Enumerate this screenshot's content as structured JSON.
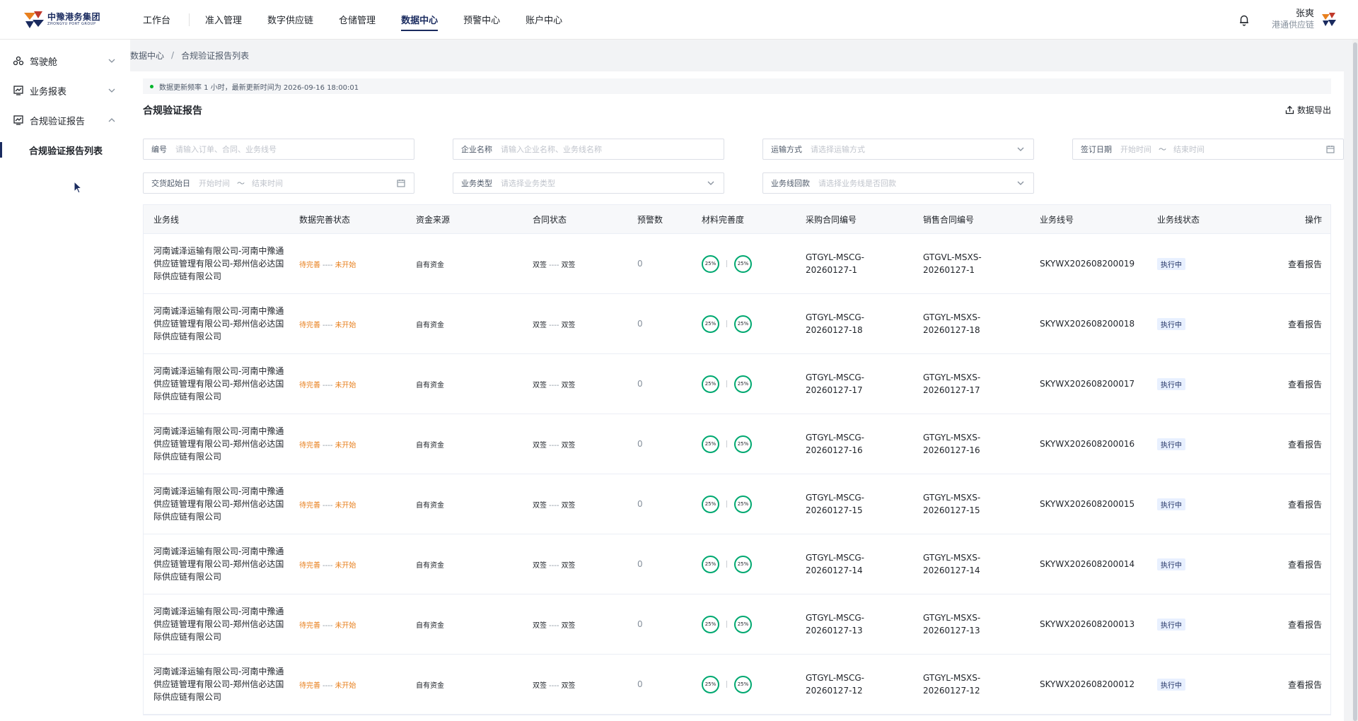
{
  "header": {
    "logo_cn": "中豫港务集团",
    "logo_en": "ZHONGYU PORT GROUP",
    "nav": [
      {
        "label": "工作台"
      },
      {
        "label": "准入管理"
      },
      {
        "label": "数字供应链"
      },
      {
        "label": "仓储管理"
      },
      {
        "label": "数据中心"
      },
      {
        "label": "预警中心"
      },
      {
        "label": "账户中心"
      }
    ],
    "active_nav": "数据中心",
    "user_name": "张爽",
    "user_org": "港通供应链"
  },
  "sidebar": {
    "items": [
      {
        "label": "驾驶舱",
        "icon": "cockpit-icon",
        "chevron": "chevron-down-icon"
      },
      {
        "label": "业务报表",
        "icon": "report-chart-icon",
        "chevron": "chevron-down-icon"
      },
      {
        "label": "合规验证报告",
        "icon": "report-chart-icon",
        "chevron": "chevron-up-icon"
      }
    ],
    "subitems": [
      {
        "label": "合规验证报告列表"
      }
    ]
  },
  "breadcrumb": {
    "parent": "数据中心",
    "separator": "/",
    "current": "合规验证报告列表"
  },
  "notice": "数据更新频率 1 小时，最新更新时间为 2026-09-16 18:00:01",
  "page_title": "合规验证报告",
  "export_label": "数据导出",
  "filters": {
    "code": {
      "label": "编号",
      "placeholder": "请输入订单、合同、业务线号"
    },
    "company": {
      "label": "企业名称",
      "placeholder": "请输入企业名称、业务线名称"
    },
    "transport": {
      "label": "运输方式",
      "placeholder": "请选择运输方式"
    },
    "sign_date": {
      "label": "签订日期",
      "start": "开始时间",
      "tilde": "～",
      "end": "结束时间"
    },
    "delivery_date": {
      "label": "交货起始日",
      "start": "开始时间",
      "tilde": "～",
      "end": "结束时间"
    },
    "biz_type": {
      "label": "业务类型",
      "placeholder": "请选择业务类型"
    },
    "payback": {
      "label": "业务线回款",
      "placeholder": "请选择业务线是否回款"
    }
  },
  "table": {
    "headers": [
      "业务线",
      "数据完善状态",
      "资金来源",
      "合同状态",
      "预警数",
      "材料完善度",
      "采购合同编号",
      "销售合同编号",
      "业务线号",
      "业务线状态",
      "操作"
    ],
    "rows": [
      {
        "biz_line": "河南诚泽运输有限公司-河南中豫通供应链管理有限公司-郑州信必达国际供应链有限公司",
        "data_status_a": "待完善",
        "data_status_dash": "----",
        "data_status_b": "未开始",
        "fund": "自有资金",
        "contract_a": "双签",
        "contract_dash": "----",
        "contract_b": "双签",
        "warn": "0",
        "mat1": "25%",
        "mat2": "25%",
        "purchase": "GTGYL-MSCG-20260127-1",
        "sales": "GTGVL-MSXS-20260127-1",
        "line_no": "SKYWX202608200019",
        "state": "执行中",
        "op": "查看报告"
      },
      {
        "biz_line": "河南诚泽运输有限公司-河南中豫通供应链管理有限公司-郑州信必达国际供应链有限公司",
        "data_status_a": "待完善",
        "data_status_dash": "----",
        "data_status_b": "未开始",
        "fund": "自有资金",
        "contract_a": "双签",
        "contract_dash": "----",
        "contract_b": "双签",
        "warn": "0",
        "mat1": "25%",
        "mat2": "25%",
        "purchase": "GTGYL-MSCG-20260127-18",
        "sales": "GTGYL-MSXS-20260127-18",
        "line_no": "SKYWX202608200018",
        "state": "执行中",
        "op": "查看报告"
      },
      {
        "biz_line": "河南诚泽运输有限公司-河南中豫通供应链管理有限公司-郑州信必达国际供应链有限公司",
        "data_status_a": "待完善",
        "data_status_dash": "----",
        "data_status_b": "未开始",
        "fund": "自有资金",
        "contract_a": "双签",
        "contract_dash": "----",
        "contract_b": "双签",
        "warn": "0",
        "mat1": "25%",
        "mat2": "25%",
        "purchase": "GTGYL-MSCG-20260127-17",
        "sales": "GTGYL-MSXS-20260127-17",
        "line_no": "SKYWX202608200017",
        "state": "执行中",
        "op": "查看报告"
      },
      {
        "biz_line": "河南诚泽运输有限公司-河南中豫通供应链管理有限公司-郑州信必达国际供应链有限公司",
        "data_status_a": "待完善",
        "data_status_dash": "----",
        "data_status_b": "未开始",
        "fund": "自有资金",
        "contract_a": "双签",
        "contract_dash": "----",
        "contract_b": "双签",
        "warn": "0",
        "mat1": "25%",
        "mat2": "25%",
        "purchase": "GTGYL-MSCG-20260127-16",
        "sales": "GTGYL-MSXS-20260127-16",
        "line_no": "SKYWX202608200016",
        "state": "执行中",
        "op": "查看报告"
      },
      {
        "biz_line": "河南诚泽运输有限公司-河南中豫通供应链管理有限公司-郑州信必达国际供应链有限公司",
        "data_status_a": "待完善",
        "data_status_dash": "----",
        "data_status_b": "未开始",
        "fund": "自有资金",
        "contract_a": "双签",
        "contract_dash": "----",
        "contract_b": "双签",
        "warn": "0",
        "mat1": "25%",
        "mat2": "25%",
        "purchase": "GTGYL-MSCG-20260127-15",
        "sales": "GTGYL-MSXS-20260127-15",
        "line_no": "SKYWX202608200015",
        "state": "执行中",
        "op": "查看报告"
      },
      {
        "biz_line": "河南诚泽运输有限公司-河南中豫通供应链管理有限公司-郑州信必达国际供应链有限公司",
        "data_status_a": "待完善",
        "data_status_dash": "----",
        "data_status_b": "未开始",
        "fund": "自有资金",
        "contract_a": "双签",
        "contract_dash": "----",
        "contract_b": "双签",
        "warn": "0",
        "mat1": "25%",
        "mat2": "25%",
        "purchase": "GTGYL-MSCG-20260127-14",
        "sales": "GTGYL-MSXS-20260127-14",
        "line_no": "SKYWX202608200014",
        "state": "执行中",
        "op": "查看报告"
      },
      {
        "biz_line": "河南诚泽运输有限公司-河南中豫通供应链管理有限公司-郑州信必达国际供应链有限公司",
        "data_status_a": "待完善",
        "data_status_dash": "----",
        "data_status_b": "未开始",
        "fund": "自有资金",
        "contract_a": "双签",
        "contract_dash": "----",
        "contract_b": "双签",
        "warn": "0",
        "mat1": "25%",
        "mat2": "25%",
        "purchase": "GTGYL-MSCG-20260127-13",
        "sales": "GTGYL-MSXS-20260127-13",
        "line_no": "SKYWX202608200013",
        "state": "执行中",
        "op": "查看报告"
      },
      {
        "biz_line": "河南诚泽运输有限公司-河南中豫通供应链管理有限公司-郑州信必达国际供应链有限公司",
        "data_status_a": "待完善",
        "data_status_dash": "----",
        "data_status_b": "未开始",
        "fund": "自有资金",
        "contract_a": "双签",
        "contract_dash": "----",
        "contract_b": "双签",
        "warn": "0",
        "mat1": "25%",
        "mat2": "25%",
        "purchase": "GTGYL-MSCG-20260127-12",
        "sales": "GTGYL-MSXS-20260127-12",
        "line_no": "SKYWX202608200012",
        "state": "执行中",
        "op": "查看报告"
      }
    ]
  },
  "colors": {
    "brand": "#1a2b5f",
    "ring": "#00a870",
    "pending": "#e8801f",
    "notice_dot": "#00b42a"
  }
}
